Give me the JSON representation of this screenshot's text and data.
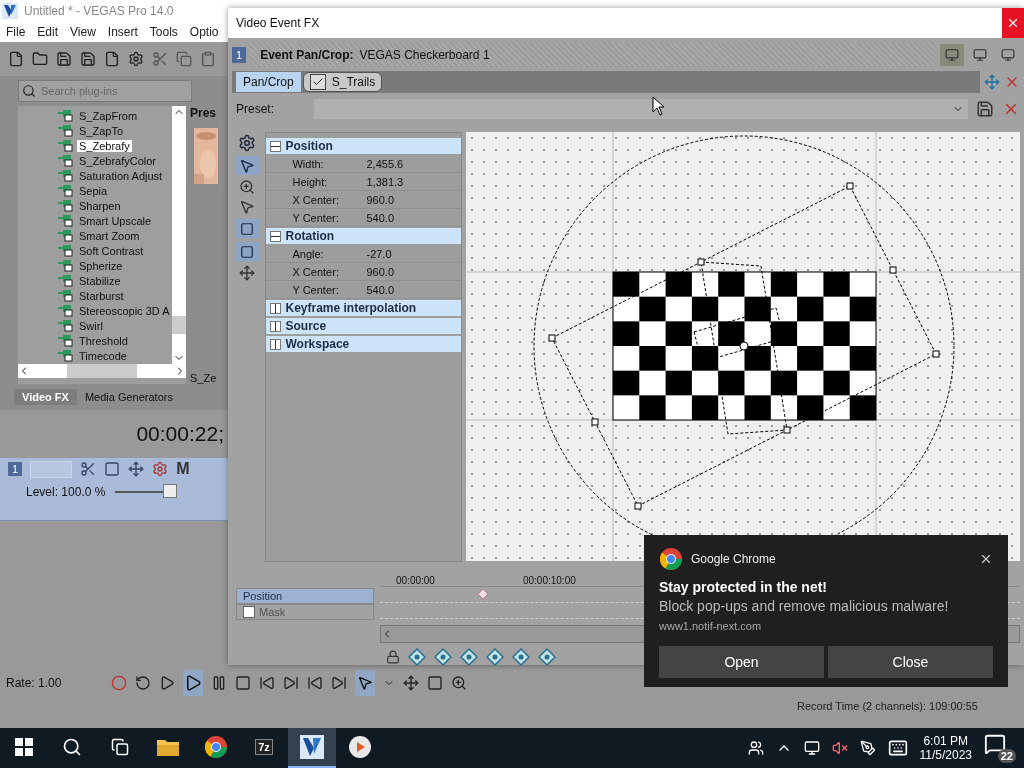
{
  "main_window": {
    "title": "Untitled * - VEGAS Pro 14.0",
    "menu": [
      "File",
      "Edit",
      "View",
      "Insert",
      "Tools",
      "Optio"
    ],
    "plugin_search": {
      "placeholder": "Search plug-ins"
    },
    "plugins": [
      {
        "label": "S_ZapFrom",
        "selected": false
      },
      {
        "label": "S_ZapTo",
        "selected": false
      },
      {
        "label": "S_Zebrafy",
        "selected": true
      },
      {
        "label": "S_ZebrafyColor",
        "selected": false
      },
      {
        "label": "Saturation Adjust",
        "selected": false
      },
      {
        "label": "Sepia",
        "selected": false
      },
      {
        "label": "Sharpen",
        "selected": false
      },
      {
        "label": "Smart Upscale",
        "selected": false
      },
      {
        "label": "Smart Zoom",
        "selected": false
      },
      {
        "label": "Soft Contrast",
        "selected": false
      },
      {
        "label": "Spherize",
        "selected": false
      },
      {
        "label": "Stabilize",
        "selected": false
      },
      {
        "label": "Starburst",
        "selected": false
      },
      {
        "label": "Stereoscopic 3D A",
        "selected": false
      },
      {
        "label": "Swirl",
        "selected": false
      },
      {
        "label": "Threshold",
        "selected": false
      },
      {
        "label": "Timecode",
        "selected": false
      }
    ],
    "preset_header": "Pres",
    "preset_caption": "S_Ze",
    "dock_tabs": [
      {
        "label": "Video FX",
        "selected": true
      },
      {
        "label": "Media Generators",
        "selected": false
      }
    ],
    "time_display": "00:00:22;",
    "track": {
      "number": "1",
      "mute_label": "M",
      "level_label": "Level: 100.0 %",
      "level": 1.0
    },
    "rate": "Rate: 1.00",
    "record_time": "Record Time (2 channels): 109:00:55"
  },
  "fx_window": {
    "title": "Video Event FX",
    "track_number": "1",
    "event_label": "Event Pan/Crop:",
    "event_name": "VEGAS Checkerboard 1",
    "chain": [
      {
        "label": "Pan/Crop",
        "kind": "plain",
        "selected": true
      },
      {
        "label": "S_Trails",
        "kind": "toggle",
        "selected": false,
        "checked": true
      }
    ],
    "preset_label": "Preset:",
    "groups": [
      {
        "label": "Position",
        "expanded": true,
        "rows": [
          {
            "label": "Width:",
            "value": "2,455.6"
          },
          {
            "label": "Height:",
            "value": "1,381.3"
          },
          {
            "label": "X Center:",
            "value": "960.0"
          },
          {
            "label": "Y Center:",
            "value": "540.0"
          }
        ]
      },
      {
        "label": "Rotation",
        "expanded": true,
        "rows": [
          {
            "label": "Angle:",
            "value": "-27.0"
          },
          {
            "label": "X Center:",
            "value": "960.0"
          },
          {
            "label": "Y Center:",
            "value": "540.0"
          }
        ]
      },
      {
        "label": "Keyframe interpolation",
        "expanded": false
      },
      {
        "label": "Source",
        "expanded": false
      },
      {
        "label": "Workspace",
        "expanded": false
      }
    ],
    "ruler": [
      "00:00:00",
      "00:00:10:00"
    ],
    "keyframe_tracks": [
      {
        "label": "Position",
        "kind": "plain",
        "selected": true,
        "disabled": false
      },
      {
        "label": "Mask",
        "kind": "checkbox",
        "selected": false,
        "checked": false,
        "disabled": true
      }
    ]
  },
  "notification": {
    "app": "Google Chrome",
    "title": "Stay protected in the net!",
    "body": "Block pop-ups and remove malicious malware!",
    "source": "www1.notif-next.com",
    "buttons": [
      "Open",
      "Close"
    ]
  },
  "taskbar": {
    "apps": [
      {
        "kind": "explorer",
        "active": false
      },
      {
        "kind": "chrome",
        "active": false
      },
      {
        "kind": "archiver",
        "glyph": "7z",
        "active": false
      },
      {
        "kind": "vegas",
        "active": true
      },
      {
        "kind": "player",
        "active": false
      }
    ],
    "time": "6:01 PM",
    "date": "11/5/2023",
    "notification_count": "22"
  }
}
